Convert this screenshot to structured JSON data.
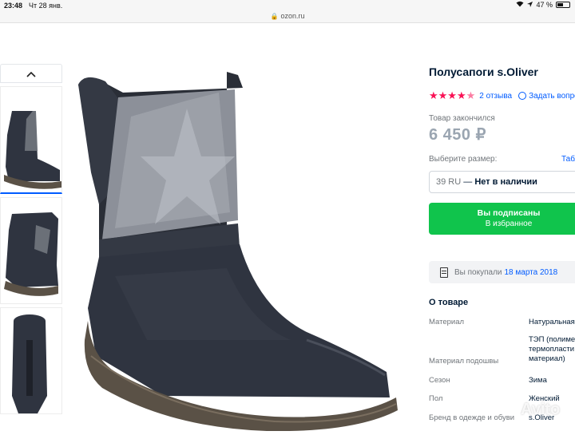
{
  "status_bar": {
    "time": "23:48",
    "date": "Чт 28 янв.",
    "battery": "47 %"
  },
  "browser": {
    "url": "ozon.ru"
  },
  "gallery": {
    "up_arrow": "⌃",
    "thumbnail_count": 3
  },
  "product": {
    "title": "Полусапоги s.Oliver",
    "rating": 4.5,
    "reviews_link": "2 отзыва",
    "ask_link": "Задать вопрос",
    "stock_status": "Товар закончился",
    "price": "6 450 ₽",
    "size_label": "Выберите размер:",
    "size_table_link": "Табл",
    "size_value": "39 RU",
    "size_dash": "—",
    "availability": "Нет в наличии",
    "subscribe_line1": "Вы подписаны",
    "subscribe_line2": "В избранное",
    "bought_text": "Вы покупали",
    "bought_date": "18 марта 2018"
  },
  "about": {
    "heading": "О товаре",
    "specs": [
      {
        "key": "Материал",
        "value": "Натуральная зам"
      },
      {
        "key": "Материал подошвы",
        "value": "ТЭП (полиме\nтермопласти\nматериал)"
      },
      {
        "key": "Сезон",
        "value": "Зима"
      },
      {
        "key": "Пол",
        "value": "Женский"
      },
      {
        "key": "Бренд в одежде и обуви",
        "value": "s.Oliver"
      }
    ]
  },
  "colors": {
    "accent": "#005bff",
    "button_green": "#10c44c",
    "star": "#f91155",
    "boot": "#2f3440",
    "sole": "#5a5146"
  },
  "watermark": "Avito"
}
